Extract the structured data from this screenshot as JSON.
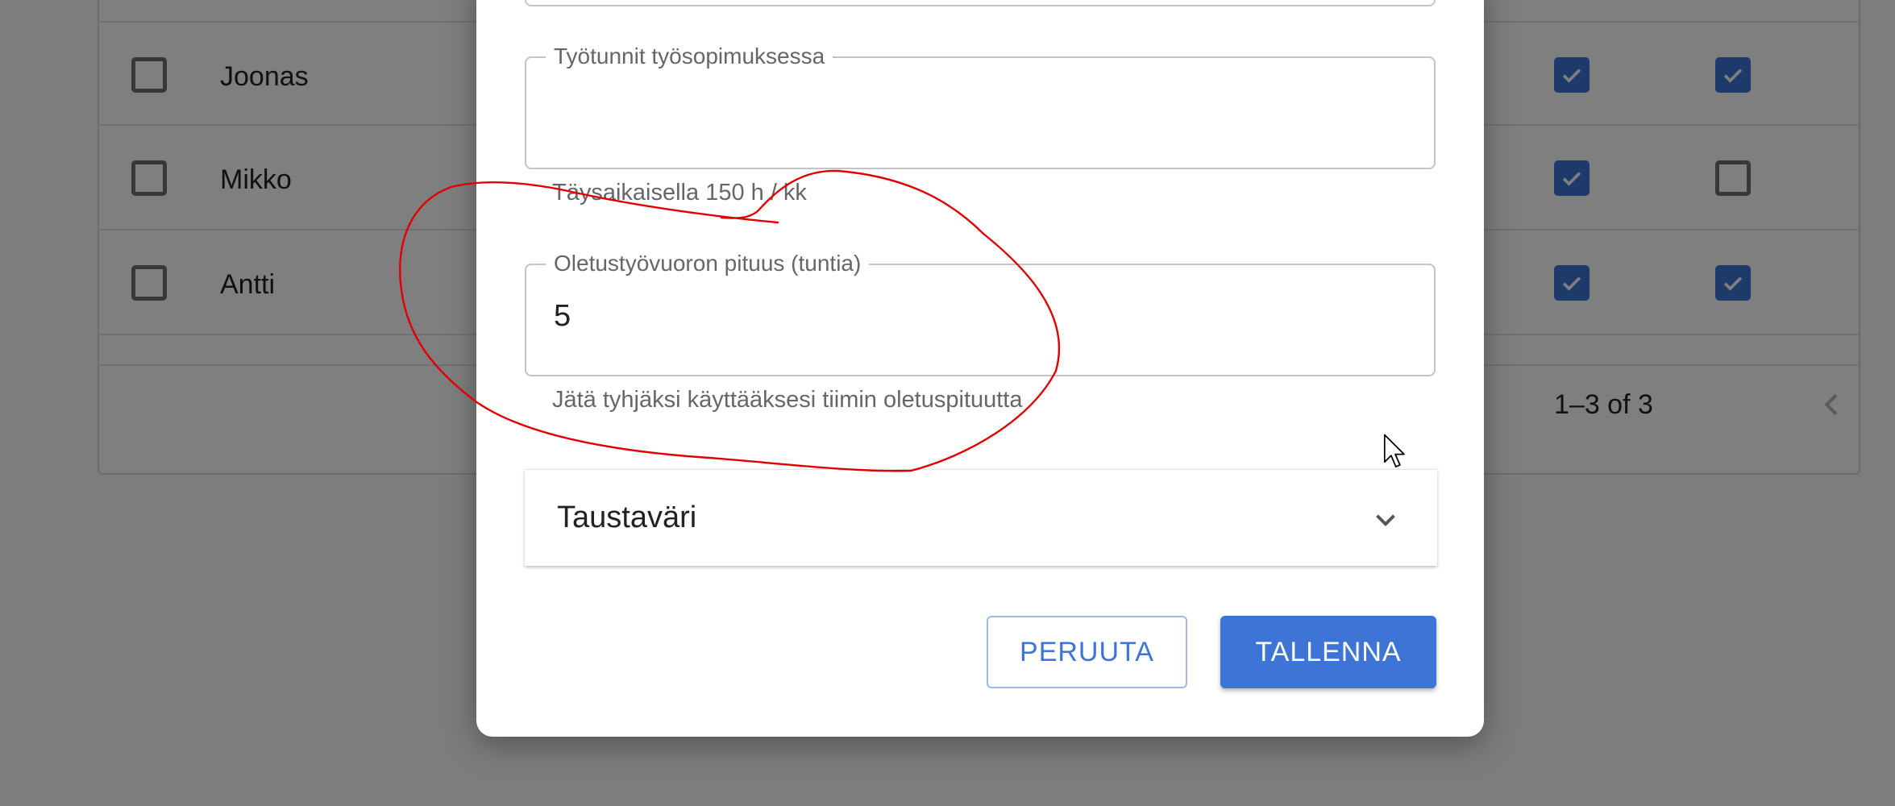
{
  "background_table": {
    "rows": [
      {
        "name": "Joonas",
        "col1_checked": true,
        "col2_checked": true
      },
      {
        "name": "Mikko",
        "col1_checked": true,
        "col2_checked": false
      },
      {
        "name": "Antti",
        "col1_checked": true,
        "col2_checked": true
      }
    ],
    "pagination_label": "1–3 of 3"
  },
  "dialog": {
    "work_hours_field": {
      "label": "Työtunnit työsopimuksessa",
      "value": "",
      "helper": "Täysaikaisella 150 h / kk"
    },
    "default_shift_field": {
      "label": "Oletustyövuoron pituus (tuntia)",
      "value": "5",
      "helper": "Jätä tyhjäksi käyttääksesi tiimin oletuspituutta"
    },
    "background_color_section": {
      "title": "Taustaväri"
    },
    "cancel_label": "PERUUTA",
    "save_label": "TALLENNA"
  },
  "colors": {
    "primary": "#3d74d6",
    "annotation": "#e00000"
  },
  "icons": [
    "checkbox-icon",
    "check-icon",
    "chevron-down-icon",
    "chevron-left-icon",
    "chevron-right-icon",
    "mouse-cursor-icon"
  ]
}
